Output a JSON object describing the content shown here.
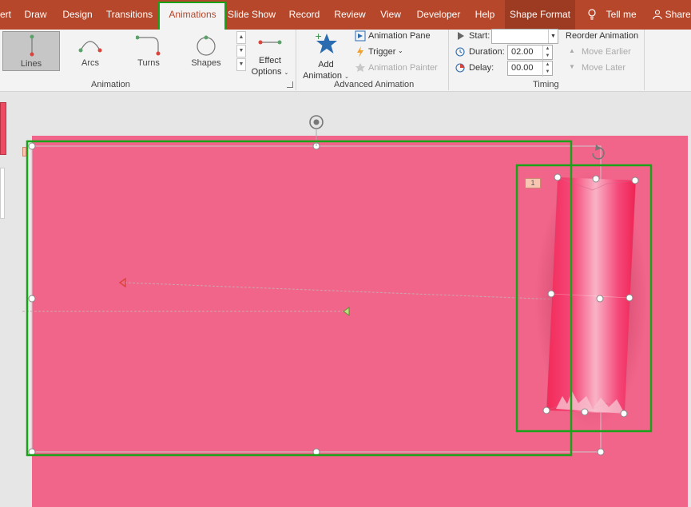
{
  "tabs": [
    "ert",
    "Draw",
    "Design",
    "Transitions",
    "Animations",
    "Slide Show",
    "Record",
    "Review",
    "View",
    "Developer",
    "Help",
    "Shape Format"
  ],
  "tell_me": "Tell me",
  "share": "Share",
  "animation_gallery": [
    "Lines",
    "Arcs",
    "Turns",
    "Shapes"
  ],
  "effect_options": [
    "Effect",
    "Options"
  ],
  "group_animation": "Animation",
  "add_animation": [
    "Add",
    "Animation"
  ],
  "animation_pane": "Animation Pane",
  "trigger": "Trigger",
  "animation_painter": "Animation Painter",
  "group_advanced": "Advanced Animation",
  "start_label": "Start:",
  "start_value": "",
  "duration_label": "Duration:",
  "duration_value": "02.00",
  "delay_label": "Delay:",
  "delay_value": "00.00",
  "group_timing": "Timing",
  "reorder_title": "Reorder Animation",
  "move_earlier": "Move Earlier",
  "move_later": "Move Later",
  "animation_tag": "1",
  "colors": {
    "tabbar": "#b7472a",
    "slide": "#f2658b",
    "highlight": "#19a319"
  }
}
